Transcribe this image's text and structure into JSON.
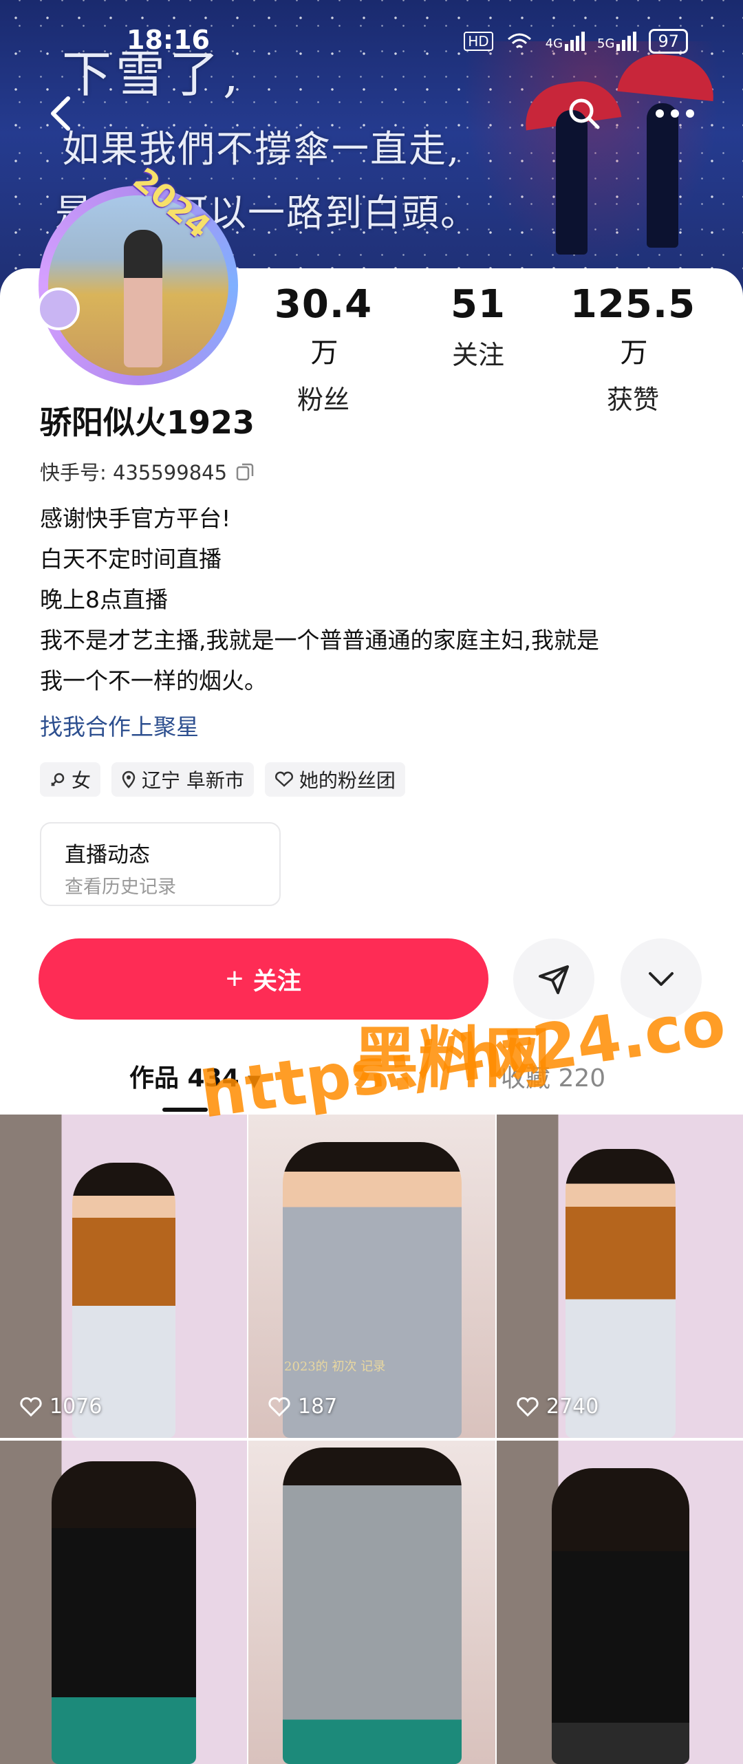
{
  "status_bar": {
    "time": "18:16",
    "hd": "HD",
    "network_4g": "4G",
    "network_5g": "5G",
    "battery": "97"
  },
  "banner": {
    "line1": "下雪了,",
    "line2": "如果我們不撐傘一直走,",
    "line3": "是不是可以一路到白頭。"
  },
  "profile": {
    "avatar_badge": "2024",
    "name": "骄阳似火1923",
    "kuaishou_id_label": "快手号:",
    "kuaishou_id": "435599845",
    "bio": [
      "感谢快手官方平台!",
      "白天不定时间直播",
      "晚上8点直播",
      "我不是才艺主播,我就是一个普普通通的家庭主妇,我就是",
      "我一个不一样的烟火。"
    ],
    "collab_link": "找我合作上聚星"
  },
  "stats": {
    "fans": {
      "value": "30.4",
      "unit": "万",
      "label": "粉丝"
    },
    "following": {
      "value": "51",
      "unit": "",
      "label": "关注"
    },
    "likes": {
      "value": "125.5",
      "unit": "万",
      "label": "获赞"
    }
  },
  "tags": {
    "gender": "女",
    "location": "辽宁 阜新市",
    "fan_group": "她的粉丝团"
  },
  "live_card": {
    "title": "直播动态",
    "subtitle": "查看历史记录"
  },
  "actions": {
    "follow_label": "关注",
    "follow_plus": "+"
  },
  "tabs": {
    "works": "作品 434",
    "favorites": "收藏 220"
  },
  "videos": [
    {
      "likes": "1076"
    },
    {
      "likes": "187",
      "stamp": "2023的 初次 记录"
    },
    {
      "likes": "2740"
    },
    {
      "likes": ""
    },
    {
      "likes": ""
    },
    {
      "likes": ""
    }
  ],
  "watermark": {
    "line1": "黑料网",
    "line2": "https://ht24.co"
  },
  "colors": {
    "follow_button": "#fe2c55",
    "link": "#2d4f8f",
    "banner": "#253b8f"
  }
}
